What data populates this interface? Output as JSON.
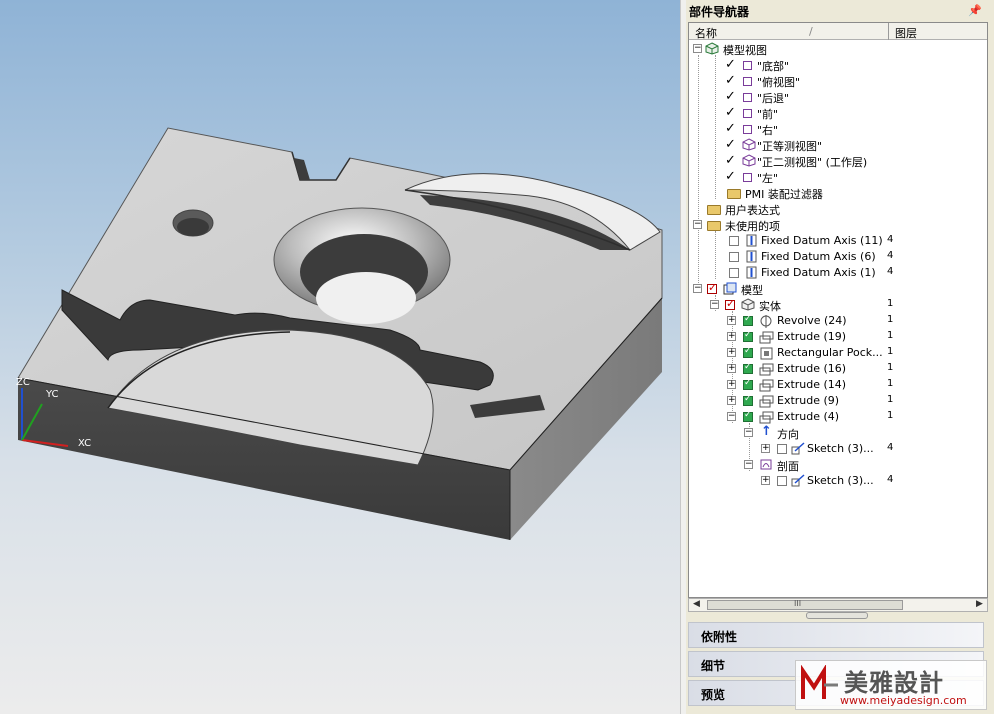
{
  "viewport": {
    "axes": {
      "zc": "ZC",
      "yc": "YC",
      "xc": "XC"
    },
    "colors": {
      "axis_x": "#d02020",
      "axis_y": "#20a020",
      "axis_z": "#2050d0"
    }
  },
  "navigator": {
    "title": "部件导航器",
    "columns": {
      "name": "名称",
      "layer": "图层"
    },
    "tree": {
      "model_views": "模型视图",
      "views": [
        "\"底部\"",
        "\"俯视图\"",
        "\"后退\"",
        "\"前\"",
        "\"右\"",
        "\"正等测视图\"",
        "\"正二测视图\" (工作层)",
        "\"左\""
      ],
      "pmi_filter": "PMI 装配过滤器",
      "user_expressions": "用户表达式",
      "unused_items": "未使用的项",
      "unused": [
        {
          "name": "Fixed Datum Axis (11)",
          "layer": "4"
        },
        {
          "name": "Fixed Datum Axis (6)",
          "layer": "4"
        },
        {
          "name": "Fixed Datum Axis (1)",
          "layer": "4"
        }
      ],
      "model": "模型",
      "solid": {
        "name": "实体",
        "layer": "1"
      },
      "features": [
        {
          "name": "Revolve (24)",
          "layer": "1"
        },
        {
          "name": "Extrude (19)",
          "layer": "1"
        },
        {
          "name": "Rectangular Pock...",
          "layer": "1"
        },
        {
          "name": "Extrude (16)",
          "layer": "1"
        },
        {
          "name": "Extrude (14)",
          "layer": "1"
        },
        {
          "name": "Extrude (9)",
          "layer": "1"
        },
        {
          "name": "Extrude (4)",
          "layer": "1"
        }
      ],
      "direction": "方向",
      "direction_sketch": {
        "name": "Sketch (3)...",
        "layer": "4"
      },
      "section": "剖面",
      "section_sketch": {
        "name": "Sketch (3)...",
        "layer": "4"
      }
    },
    "scrollbar": {
      "grip": "III"
    },
    "panels": [
      "依附性",
      "细节",
      "预览"
    ]
  },
  "watermark": {
    "title": "美雅設計",
    "url": "www.meiyadesign.com"
  }
}
